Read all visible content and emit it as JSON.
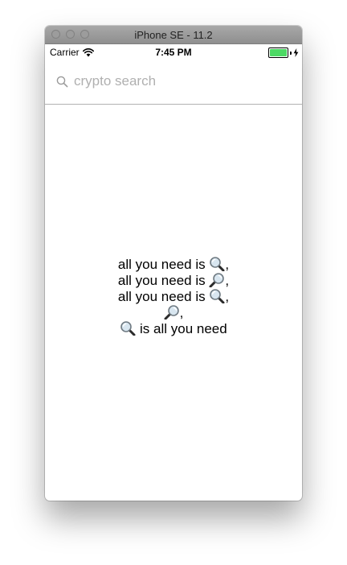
{
  "window": {
    "title": "iPhone SE - 11.2"
  },
  "status_bar": {
    "carrier": "Carrier",
    "time": "7:45 PM",
    "battery_color": "#4cd964"
  },
  "search": {
    "placeholder": "crypto search",
    "icon": "search-icon"
  },
  "message": {
    "lines": [
      {
        "text": "all you need is ",
        "icon": "magnifier-left-icon",
        "suffix": ","
      },
      {
        "text": "all you need is ",
        "icon": "magnifier-right-icon",
        "suffix": ","
      },
      {
        "text": "all you need is ",
        "icon": "magnifier-left-icon",
        "suffix": ","
      },
      {
        "text": "",
        "icon": "magnifier-right-icon",
        "suffix": ","
      },
      {
        "text": " is all you need",
        "icon": "magnifier-left-icon",
        "icon_first": true
      }
    ]
  }
}
